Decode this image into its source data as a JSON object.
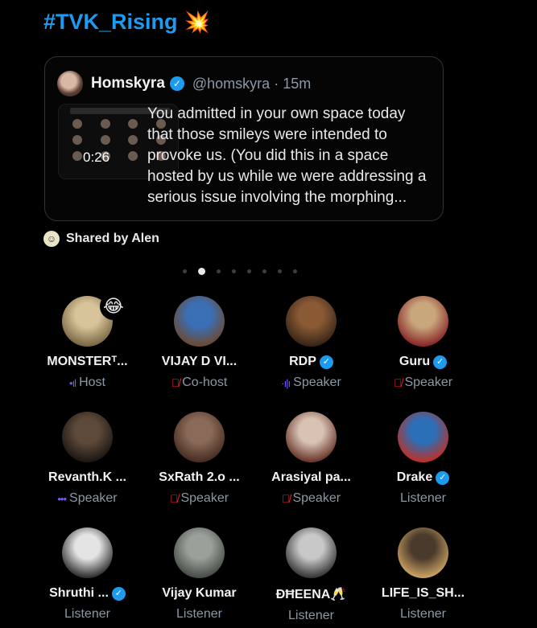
{
  "header": {
    "title": "#TVK_Rising",
    "title_icon": "sparkle-burst-icon"
  },
  "quote": {
    "name": "Homskyra",
    "handle": "@homskyra",
    "time": "15m",
    "thumbnail_time": "0:26",
    "text": "You admitted in your own space today that those smileys were intended to provoke us. (You did this in a space hosted by us while we were addressing a serious issue involving the morphing..."
  },
  "shared_by": "Shared by Alen",
  "pagination": {
    "count": 8,
    "active_index": 1
  },
  "participants": [
    {
      "name": "MONSTERᵀ...",
      "role": "Host",
      "role_icon": "host-bars-icon",
      "verified": false,
      "badge": "😂",
      "avatar": [
        "#d8c49a",
        "#7a6a45"
      ]
    },
    {
      "name": "VIJAY D VI...",
      "role": "Co-host",
      "role_icon": "mic-off-icon",
      "verified": false,
      "avatar": [
        "#3b6fb6",
        "#6b4a35"
      ]
    },
    {
      "name": "RDP",
      "role": "Speaker",
      "role_icon": "speaking-bars-icon",
      "verified": true,
      "avatar": [
        "#8a5a35",
        "#3a2618"
      ]
    },
    {
      "name": "Guru",
      "role": "Speaker",
      "role_icon": "mic-off-icon",
      "verified": true,
      "avatar": [
        "#c9a77c",
        "#8a2a2a"
      ]
    },
    {
      "name": "Revanth.K ...",
      "role": "Speaker",
      "role_icon": "speaking-dots-icon",
      "verified": false,
      "avatar": [
        "#5e4a3a",
        "#1e1814"
      ]
    },
    {
      "name": "SxRath 2.o ...",
      "role": "Speaker",
      "role_icon": "mic-off-icon",
      "verified": false,
      "avatar": [
        "#8a6a58",
        "#4a2e24"
      ]
    },
    {
      "name": "Arasiyal pa...",
      "role": "Speaker",
      "role_icon": "mic-off-icon",
      "verified": false,
      "avatar": [
        "#d8c2b4",
        "#6b3a2c"
      ]
    },
    {
      "name": "Drake",
      "role": "Listener",
      "role_icon": "",
      "verified": true,
      "avatar": [
        "#2a6fb8",
        "#b8332a"
      ]
    },
    {
      "name": "Shruthi ...",
      "role": "Listener",
      "role_icon": "",
      "verified": true,
      "avatar": [
        "#e4e4e4",
        "#333333"
      ]
    },
    {
      "name": "Vijay Kumar",
      "role": "Listener",
      "role_icon": "",
      "verified": false,
      "avatar": [
        "#9aa09a",
        "#4a4e4a"
      ]
    },
    {
      "name": "ÐĦEENA🥂",
      "role": "Listener",
      "role_icon": "",
      "verified": false,
      "avatar": [
        "#c8c8c8",
        "#3a3a3a"
      ]
    },
    {
      "name": "LIFE_IS_SH...",
      "role": "Listener",
      "role_icon": "",
      "verified": false,
      "avatar": [
        "#4a3a2c",
        "#c8a060"
      ]
    }
  ]
}
